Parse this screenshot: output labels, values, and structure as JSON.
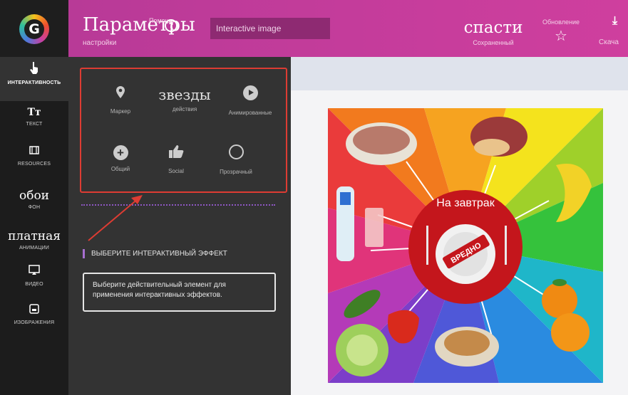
{
  "header": {
    "title": "Параметры",
    "subtitle": "настройки",
    "help_label": "Помощь",
    "project_name": "Interactive image",
    "save_title": "спасти",
    "save_sub": "Сохраненный",
    "update_label": "Обновление",
    "download_label": "Скача"
  },
  "sidebar": {
    "items": [
      {
        "icon": "hand-pointer-icon",
        "label": "ИНТЕРАКТИВНОСТЬ"
      },
      {
        "icon": "text-icon",
        "glyph": "Tт",
        "label": "ТЕКСТ"
      },
      {
        "icon": "resources-icon",
        "label": "RESOURCES"
      },
      {
        "big": "обои",
        "label": "ФОН"
      },
      {
        "big": "платная",
        "label": "АНИМАЦИИ"
      },
      {
        "icon": "video-icon",
        "label": "ВИДЕО"
      },
      {
        "icon": "image-icon",
        "label": "ИЗОБРАЖЕНИЯ"
      }
    ]
  },
  "panel": {
    "effects": [
      {
        "icon": "map-marker-icon",
        "label": "Маркер"
      },
      {
        "word": "звезды",
        "label": "действия"
      },
      {
        "icon": "play-circle-icon",
        "label": "Анимированные"
      },
      {
        "icon": "plus-circle-icon",
        "label": "Общий"
      },
      {
        "icon": "thumbs-up-icon",
        "label": "Social"
      },
      {
        "icon": "circle-outline-icon",
        "label": "Прозрачный"
      }
    ],
    "section_title": "ВЫБЕРИТЕ ИНТЕРАКТИВНЫЙ ЭФФЕКТ",
    "hint": "Выберите действительный элемент для применения интерактивных эффектов."
  },
  "image": {
    "center_label": "На завтрак",
    "stamp_text": "ВРЕДНО"
  },
  "colors": {
    "header_accent": "#c43c9b",
    "sidebar_bg": "#1c1c1c",
    "panel_bg": "#333333",
    "highlight_border": "#dd3c33",
    "divider_dots": "#8d56c2"
  }
}
